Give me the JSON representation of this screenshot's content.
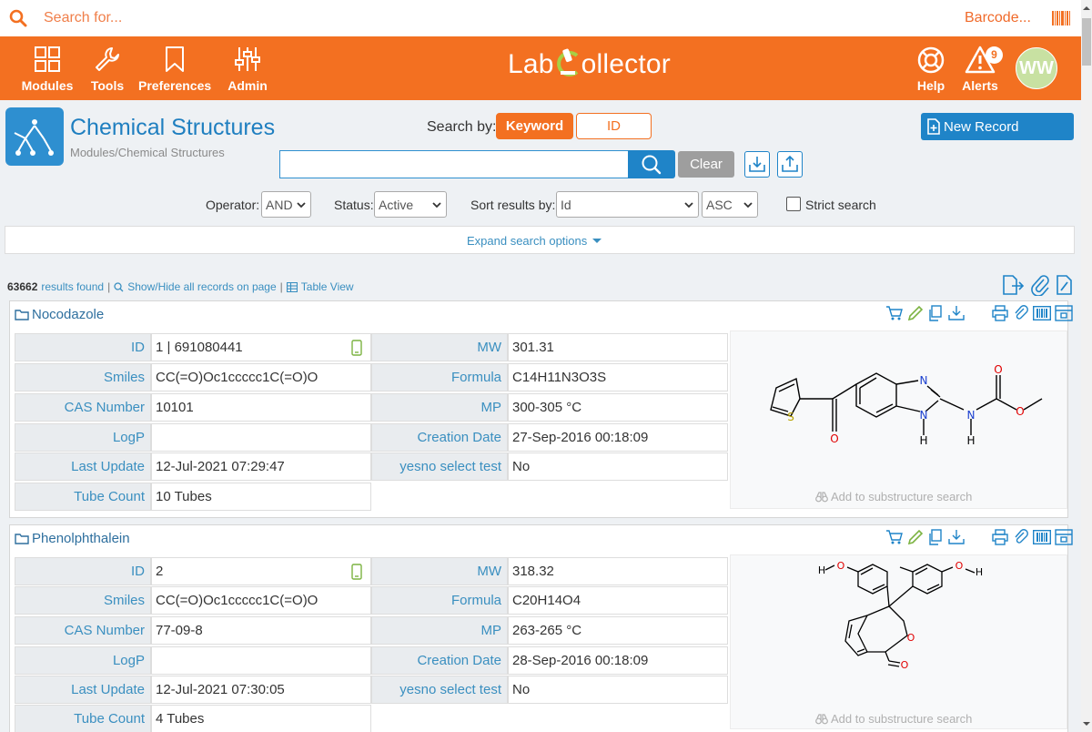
{
  "top_search": {
    "placeholder": "Search for...",
    "barcode_label": "Barcode..."
  },
  "nav": {
    "items": [
      {
        "label": "Modules",
        "icon": "grid-icon"
      },
      {
        "label": "Tools",
        "icon": "wrench-icon"
      },
      {
        "label": "Preferences",
        "icon": "bookmark-icon"
      },
      {
        "label": "Admin",
        "icon": "sliders-icon"
      }
    ],
    "logo": {
      "left": "Lab",
      "right": "ollector"
    },
    "help_label": "Help",
    "alerts_label": "Alerts",
    "alerts_count": "9",
    "avatar_initials": "WW"
  },
  "page": {
    "title": "Chemical Structures",
    "breadcrumb": "Modules/Chemical Structures"
  },
  "search": {
    "search_by_label": "Search by:",
    "keyword_label": "Keyword",
    "id_label": "ID",
    "input_value": "",
    "clear_label": "Clear",
    "new_record_label": "New Record"
  },
  "filters": {
    "operator_label": "Operator:",
    "operator_value": "AND",
    "status_label": "Status:",
    "status_value": "Active",
    "sort_label": "Sort results by:",
    "sort_value": "Id",
    "order_value": "ASC",
    "strict_label": "Strict search",
    "strict_checked": false,
    "expand_label": "Expand search options"
  },
  "results": {
    "count": "63662",
    "found_label": "results found",
    "sep1": "|",
    "show_hide_label": "Show/Hide all records on page",
    "sep2": "|",
    "table_view_label": "Table View"
  },
  "records": [
    {
      "name": "Nocodazole",
      "fields": {
        "id_label": "ID",
        "id_value": "1  | 691080441",
        "smiles_label": "Smiles",
        "smiles_value": "CC(=O)Oc1ccccc1C(=O)O",
        "cas_label": "CAS Number",
        "cas_value": "10101",
        "logp_label": "LogP",
        "logp_value": "",
        "last_update_label": "Last Update",
        "last_update_value": "12-Jul-2021 07:29:47",
        "tube_count_label": "Tube Count",
        "tube_count_value": "10 Tubes",
        "mw_label": "MW",
        "mw_value": "301.31",
        "formula_label": "Formula",
        "formula_value": "C14H11N3O3S",
        "mp_label": "MP",
        "mp_value": "300-305 °C",
        "creation_label": "Creation Date",
        "creation_value": "27-Sep-2016 00:18:09",
        "yesno_label": "yesno select test",
        "yesno_value": "No"
      },
      "structure_atoms": {
        "s": "S",
        "o1": "O",
        "n1": "N",
        "n2": "N",
        "h1": "H",
        "n3": "N",
        "h2": "H",
        "o2": "O",
        "o3": "O"
      },
      "substructure_label": "Add to substructure search"
    },
    {
      "name": "Phenolphthalein",
      "fields": {
        "id_label": "ID",
        "id_value": "2",
        "smiles_label": "Smiles",
        "smiles_value": "CC(=O)Oc1ccccc1C(=O)O",
        "cas_label": "CAS Number",
        "cas_value": "77-09-8",
        "logp_label": "LogP",
        "logp_value": "",
        "last_update_label": "Last Update",
        "last_update_value": "12-Jul-2021 07:30:05",
        "tube_count_label": "Tube Count",
        "tube_count_value": "4 Tubes",
        "mw_label": "MW",
        "mw_value": "318.32",
        "formula_label": "Formula",
        "formula_value": "C20H14O4",
        "mp_label": "MP",
        "mp_value": "263-265 °C",
        "creation_label": "Creation Date",
        "creation_value": "28-Sep-2016 00:18:09",
        "yesno_label": "yesno select test",
        "yesno_value": "No"
      },
      "structure_atoms": {
        "h1": "H",
        "o1": "O",
        "o2": "O",
        "h2": "H",
        "o3": "O",
        "o4": "O"
      },
      "substructure_label": "Add to substructure search"
    }
  ],
  "colors": {
    "brand_orange": "#f37021",
    "primary_blue": "#1f84c8",
    "link_blue": "#3a8fc0"
  }
}
